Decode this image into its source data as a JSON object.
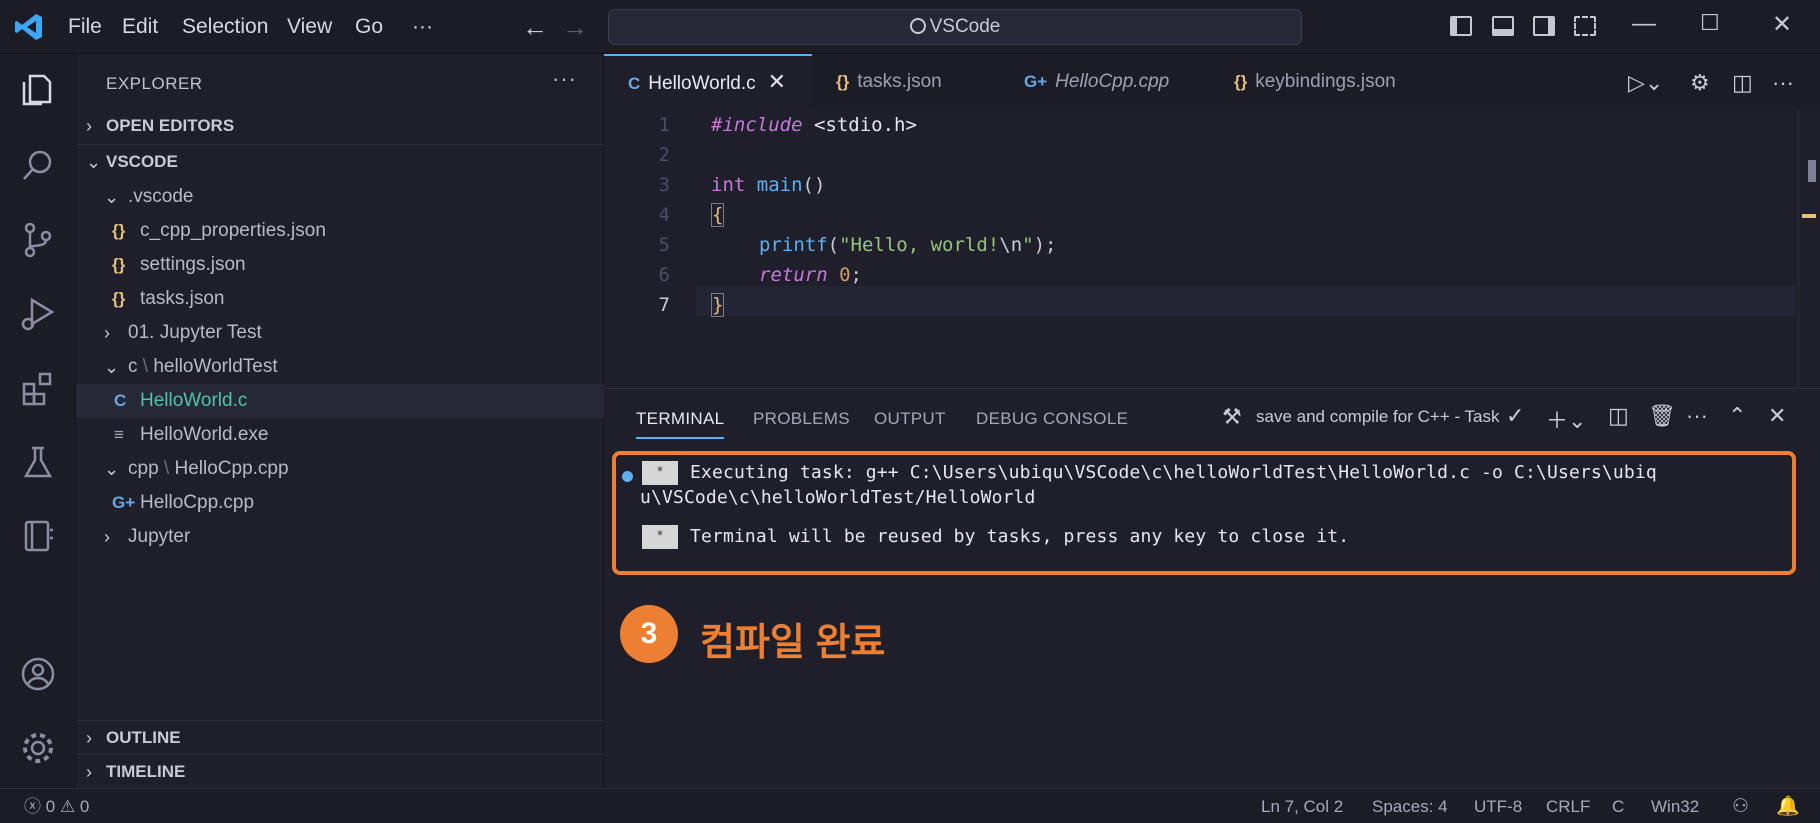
{
  "titlebar": {
    "menus": [
      "File",
      "Edit",
      "Selection",
      "View",
      "Go",
      "···"
    ],
    "command_center": "VSCode"
  },
  "sidebar": {
    "title": "EXPLORER",
    "more": "···",
    "open_editors": "OPEN EDITORS",
    "root": "VSCODE",
    "tree": {
      "vscode_folder": ".vscode",
      "c_cpp_properties": "c_cpp_properties.json",
      "settings": "settings.json",
      "tasks": "tasks.json",
      "jupyter_test": "01. Jupyter Test",
      "c_folder": "c",
      "c_sub": "helloWorldTest",
      "hello_c": "HelloWorld.c",
      "hello_exe": "HelloWorld.exe",
      "cpp_folder": "cpp",
      "cpp_sub": "HelloCpp.cpp",
      "hello_cpp": "HelloCpp.cpp",
      "jupyter": "Jupyter"
    },
    "outline": "OUTLINE",
    "timeline": "TIMELINE"
  },
  "tabs": [
    {
      "label": "HelloWorld.c",
      "icon": "C",
      "active": true
    },
    {
      "label": "tasks.json",
      "icon": "{}"
    },
    {
      "label": "HelloCpp.cpp",
      "icon": "G+"
    },
    {
      "label": "keybindings.json",
      "icon": "{}"
    }
  ],
  "editor": {
    "line_numbers": [
      "1",
      "2",
      "3",
      "4",
      "5",
      "6",
      "7"
    ],
    "include_kw": "#include",
    "include_hdr": "<stdio.h>",
    "int_kw": "int",
    "main_fn": "main",
    "paren": "()",
    "brace_open": "{",
    "printf_fn": "printf",
    "printf_open": "(",
    "printf_str": "\"Hello, world!",
    "printf_esc": "\\n",
    "printf_end": "\"",
    "printf_close": ");",
    "return_kw": "return",
    "return_val": "0",
    "semicolon": ";",
    "brace_close": "}"
  },
  "panel": {
    "tabs": [
      "TERMINAL",
      "PROBLEMS",
      "OUTPUT",
      "DEBUG CONSOLE"
    ],
    "task": "save and compile for C++ - Task",
    "terminal_lines": [
      "Executing task: g++ C:\\Users\\ubiqu\\VSCode\\c\\helloWorldTest\\HelloWorld.c -o C:\\Users\\ubiq",
      "u\\VSCode\\c\\helloWorldTest/HelloWorld",
      "Terminal will be reused by tasks, press any key to close it."
    ],
    "badge_number": "3",
    "annotation": "컴파일 완료",
    "accent": "#ec7f32"
  },
  "status": {
    "errors": "0",
    "warnings": "0",
    "position": "Ln 7, Col 2",
    "spaces": "Spaces: 4",
    "encoding": "UTF-8",
    "eol": "CRLF",
    "language": "C",
    "platform": "Win32"
  }
}
